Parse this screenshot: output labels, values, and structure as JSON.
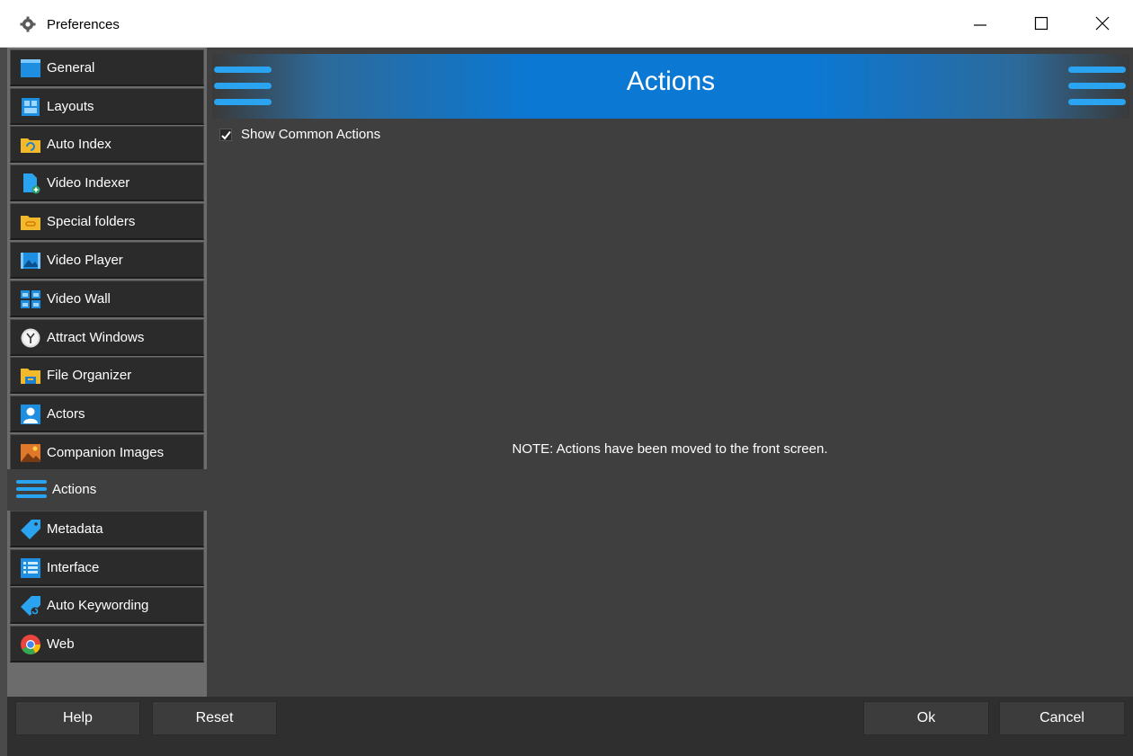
{
  "window": {
    "title": "Preferences",
    "icon": "gear-icon"
  },
  "sidebar": {
    "items": [
      {
        "label": "General",
        "icon": "window-icon"
      },
      {
        "label": "Layouts",
        "icon": "layout-icon"
      },
      {
        "label": "Auto Index",
        "icon": "folder-sync-icon"
      },
      {
        "label": "Video Indexer",
        "icon": "file-add-icon"
      },
      {
        "label": "Special folders",
        "icon": "folder-link-icon"
      },
      {
        "label": "Video Player",
        "icon": "video-player-icon"
      },
      {
        "label": "Video Wall",
        "icon": "video-wall-icon"
      },
      {
        "label": "Attract Windows",
        "icon": "clock-icon"
      },
      {
        "label": "File Organizer",
        "icon": "folder-organizer-icon"
      },
      {
        "label": "Actors",
        "icon": "person-icon"
      },
      {
        "label": "Companion Images",
        "icon": "image-icon"
      },
      {
        "label": "Actions",
        "icon": "actions-lines-icon",
        "active": true
      },
      {
        "label": "Metadata",
        "icon": "tag-icon"
      },
      {
        "label": "Interface",
        "icon": "interface-list-icon"
      },
      {
        "label": "Auto Keywording",
        "icon": "tag-sync-icon"
      },
      {
        "label": "Web",
        "icon": "browser-icon"
      }
    ]
  },
  "main": {
    "header_title": "Actions",
    "show_common_actions": {
      "label": "Show Common Actions",
      "checked": true
    },
    "note": "NOTE: Actions have been moved to the front screen."
  },
  "footer": {
    "help_label": "Help",
    "reset_label": "Reset",
    "ok_label": "Ok",
    "cancel_label": "Cancel"
  },
  "colors": {
    "accent": "#0b78d4",
    "panel": "#3f3f3f",
    "nav_item": "#2b2b2b"
  }
}
